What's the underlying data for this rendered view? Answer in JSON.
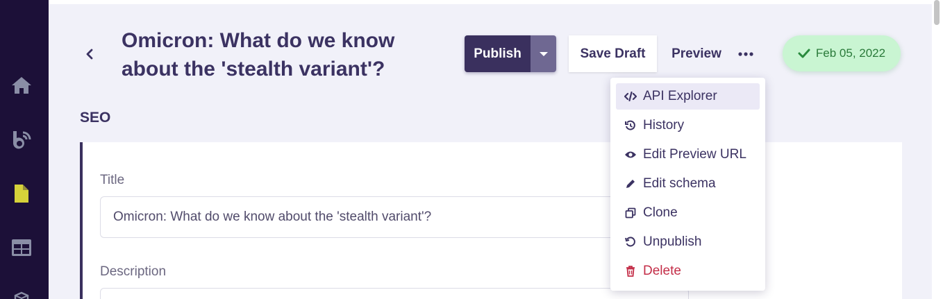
{
  "header": {
    "title": "Omicron: What do we know about the 'stealth variant'?",
    "publish_label": "Publish",
    "save_draft_label": "Save Draft",
    "preview_label": "Preview",
    "published_date": "Feb 05, 2022"
  },
  "seo": {
    "section_title": "SEO",
    "title_label": "Title",
    "title_value": "Omicron: What do we know about the 'stealth variant'?",
    "description_label": "Description",
    "description_value": ""
  },
  "actions_menu": {
    "items": [
      {
        "label": "API Explorer",
        "icon": "code-icon",
        "active": true
      },
      {
        "label": "History",
        "icon": "history-icon"
      },
      {
        "label": "Edit Preview URL",
        "icon": "eye-icon"
      },
      {
        "label": "Edit schema",
        "icon": "pencil-icon"
      },
      {
        "label": "Clone",
        "icon": "clone-icon"
      },
      {
        "label": "Unpublish",
        "icon": "undo-icon"
      },
      {
        "label": "Delete",
        "icon": "trash-icon",
        "danger": true
      }
    ]
  },
  "sidebar": {
    "items": [
      {
        "icon": "home-icon"
      },
      {
        "icon": "blog-icon"
      },
      {
        "icon": "document-icon",
        "active": true
      },
      {
        "icon": "grid-icon"
      },
      {
        "icon": "box-icon"
      }
    ]
  },
  "colors": {
    "sidebar_bg": "#1c1038",
    "accent": "#3a305e",
    "success_bg": "#c9f5d2",
    "danger": "#c42e48",
    "active_doc": "#d6d23a"
  }
}
